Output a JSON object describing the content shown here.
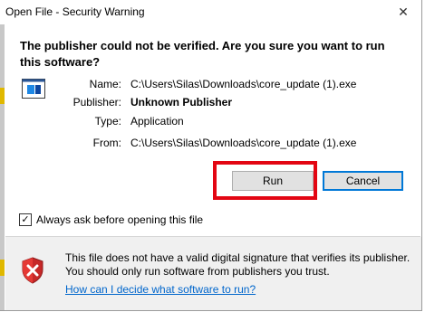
{
  "window": {
    "title": "Open File - Security Warning",
    "close_glyph": "✕"
  },
  "headline": "The publisher could not be verified.  Are you sure you want to run this software?",
  "file_info": {
    "icon": "executable-file-icon",
    "rows": [
      {
        "label": "Name:",
        "value": "C:\\Users\\Silas\\Downloads\\core_update (1).exe"
      },
      {
        "label": "Publisher:",
        "value": "Unknown Publisher"
      },
      {
        "label": "Type:",
        "value": "Application"
      },
      {
        "label": "From:",
        "value": "C:\\Users\\Silas\\Downloads\\core_update (1).exe"
      }
    ]
  },
  "buttons": {
    "run": "Run",
    "cancel": "Cancel"
  },
  "checkbox": {
    "label": "Always ask before opening this file",
    "checked": true,
    "check_glyph": "✓"
  },
  "footer": {
    "icon": "shield-error-icon",
    "warning_text": "This file does not have a valid digital signature that verifies its publisher.  You should only run software from publishers you trust.",
    "link_text": "How can I decide what software to run?"
  },
  "colors": {
    "highlight": "#e30613",
    "link": "#0066cc",
    "focus_border": "#0078d7"
  }
}
